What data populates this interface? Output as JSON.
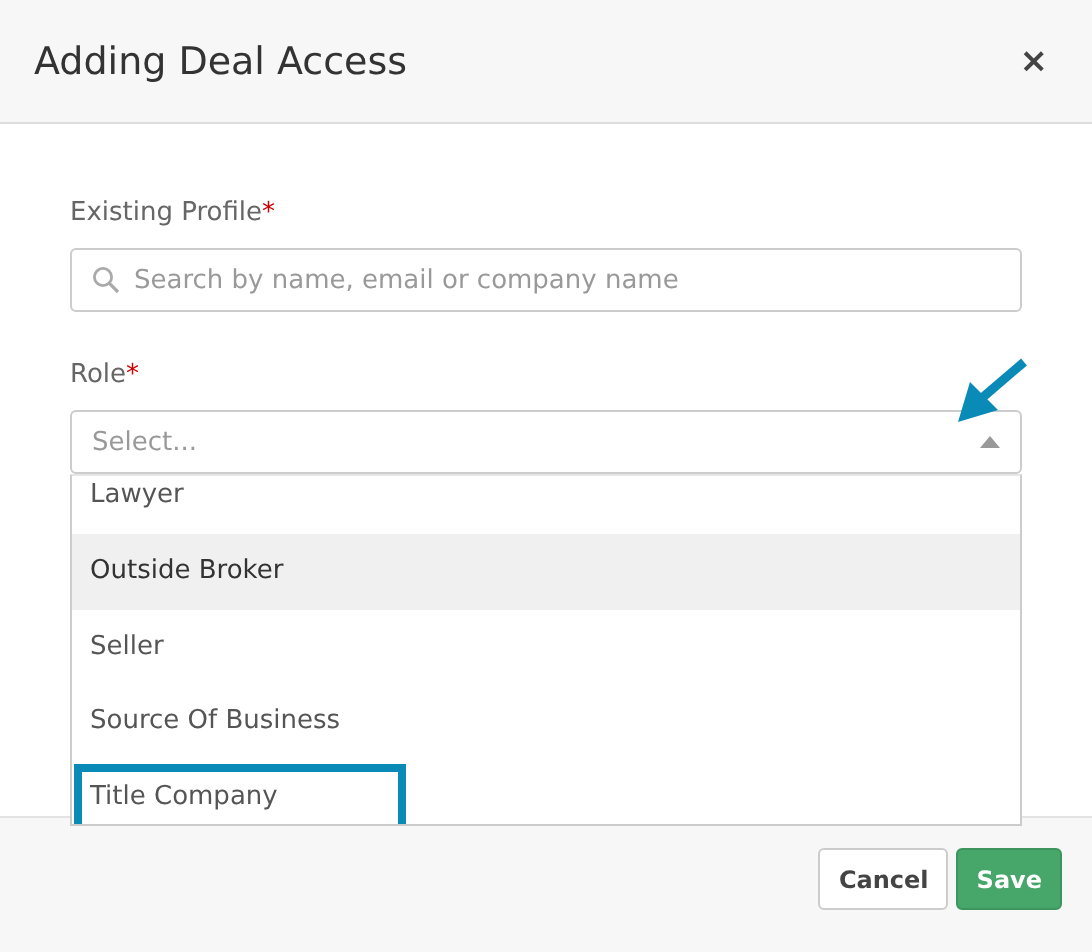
{
  "dialog": {
    "title": "Adding Deal Access",
    "close": "×"
  },
  "fields": [
    {
      "kind": "search",
      "label": "Existing Profile",
      "required_mark": "*",
      "placeholder": "Search by name, email or company name"
    },
    {
      "kind": "select",
      "label": "Role",
      "required_mark": "*",
      "placeholder": "Select...",
      "expanded": true,
      "options": [
        {
          "label": "Lawyer",
          "selected": false,
          "outlined": false
        },
        {
          "label": "Outside Broker",
          "selected": true,
          "outlined": false
        },
        {
          "label": "Seller",
          "selected": false,
          "outlined": false
        },
        {
          "label": "Source Of Business",
          "selected": false,
          "outlined": false
        },
        {
          "label": "Title Company",
          "selected": false,
          "outlined": true
        }
      ]
    }
  ],
  "buttons": [
    {
      "kind": "secondary",
      "label": "Cancel"
    },
    {
      "kind": "primary",
      "label": "Save"
    }
  ]
}
